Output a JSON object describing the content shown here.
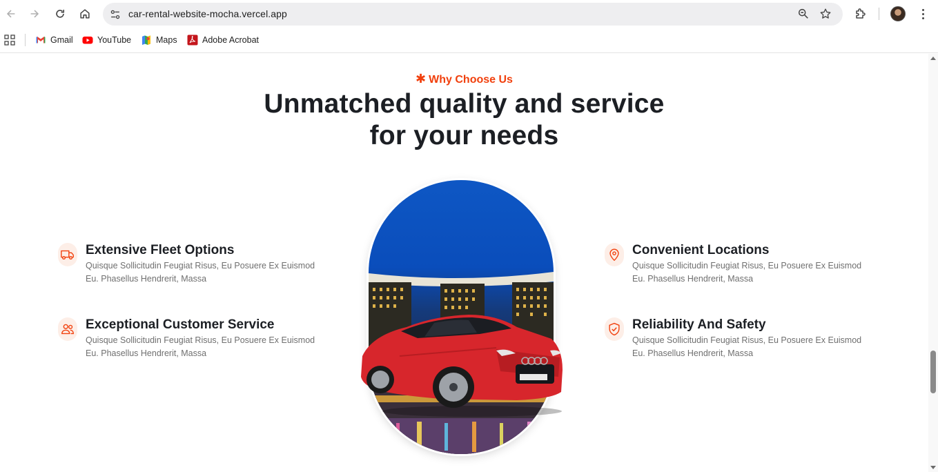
{
  "browser": {
    "url": "car-rental-website-mocha.vercel.app",
    "bookmarks": [
      {
        "label": "Gmail",
        "icon": "gmail-icon"
      },
      {
        "label": "YouTube",
        "icon": "youtube-icon"
      },
      {
        "label": "Maps",
        "icon": "maps-icon"
      },
      {
        "label": "Adobe Acrobat",
        "icon": "acrobat-icon"
      }
    ]
  },
  "section": {
    "eyebrow": "Why Choose Us",
    "heading_line1": "Unmatched quality and service",
    "heading_line2": "for your needs",
    "accent_color": "#f1400d"
  },
  "features": [
    {
      "title": "Extensive Fleet Options",
      "description": "Quisque Sollicitudin Feugiat Risus, Eu Posuere Ex Euismod Eu. Phasellus Hendrerit, Massa",
      "icon": "truck-icon"
    },
    {
      "title": "Exceptional Customer Service",
      "description": "Quisque Sollicitudin Feugiat Risus, Eu Posuere Ex Euismod Eu. Phasellus Hendrerit, Massa",
      "icon": "users-icon"
    },
    {
      "title": "Convenient Locations",
      "description": "Quisque Sollicitudin Feugiat Risus, Eu Posuere Ex Euismod Eu. Phasellus Hendrerit, Massa",
      "icon": "location-pin-icon"
    },
    {
      "title": "Reliability And Safety",
      "description": "Quisque Sollicitudin Feugiat Risus, Eu Posuere Ex Euismod Eu. Phasellus Hendrerit, Massa",
      "icon": "shield-check-icon"
    }
  ]
}
